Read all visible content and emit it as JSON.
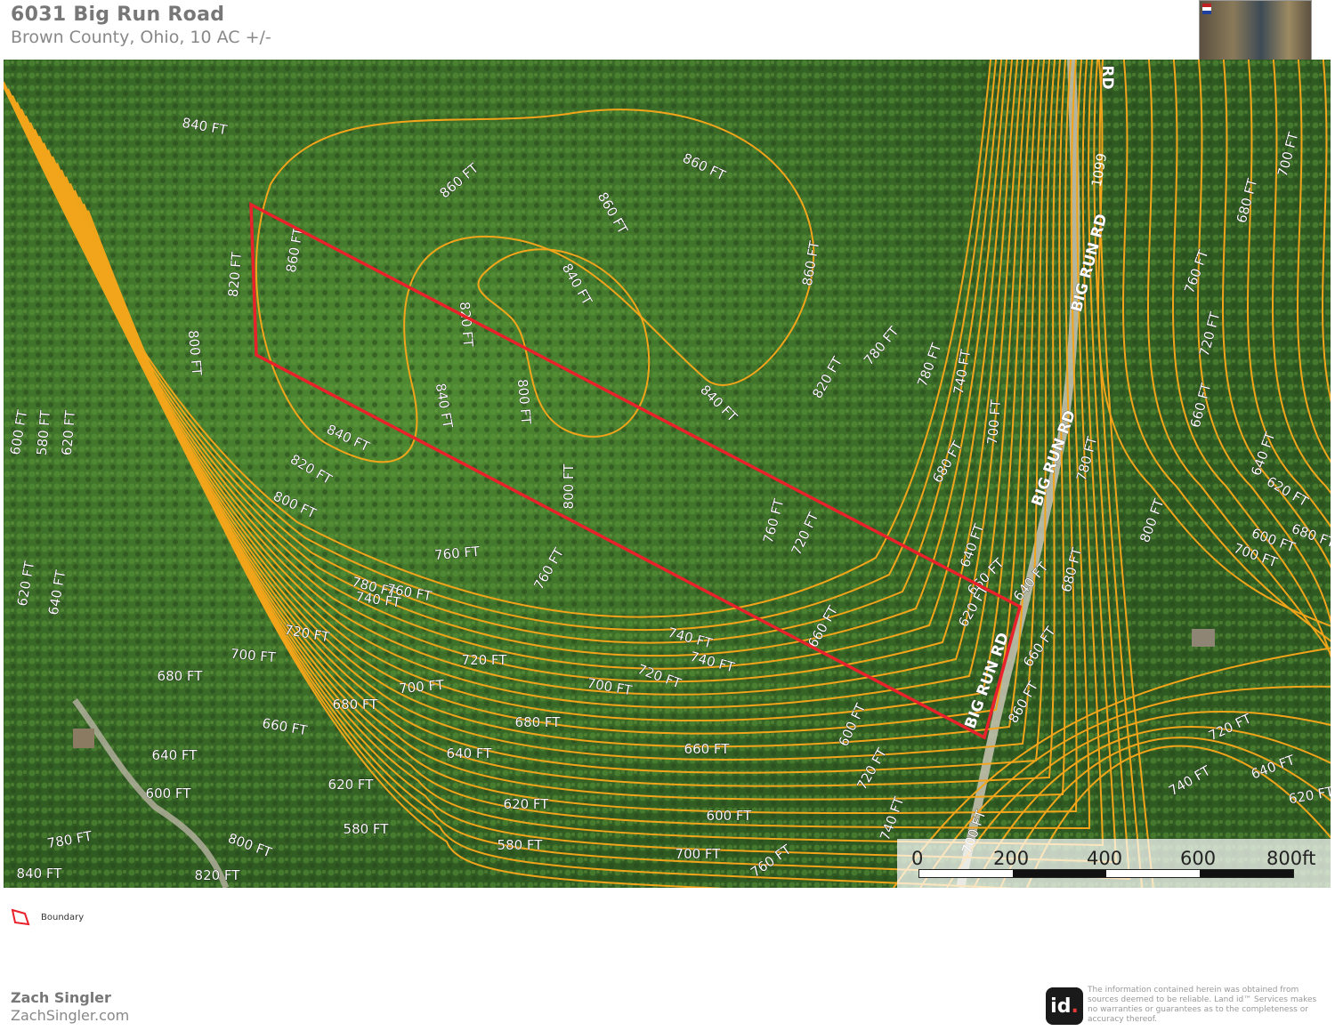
{
  "header": {
    "title": "6031 Big Run Road",
    "subtitle": "Brown County, Ohio, 10 AC +/-"
  },
  "map": {
    "contour_color": "#f2a51a",
    "boundary_color": "#e8212b",
    "contour_labels": [
      "840 FT",
      "860 FT",
      "860 FT",
      "860 FT",
      "860 FT",
      "860 FT",
      "840 FT",
      "840 FT",
      "840 FT",
      "840 FT",
      "820 FT",
      "820 FT",
      "820 FT",
      "820 FT",
      "800 FT",
      "800 FT",
      "800 FT",
      "800 FT",
      "780 FT",
      "780 FT",
      "780 FT",
      "760 FT",
      "760 FT",
      "760 FT",
      "760 FT",
      "740 FT",
      "740 FT",
      "740 FT",
      "740 FT",
      "720 FT",
      "720 FT",
      "720 FT",
      "720 FT",
      "700 FT",
      "700 FT",
      "700 FT",
      "700 FT",
      "680 FT",
      "680 FT",
      "680 FT",
      "680 FT",
      "660 FT",
      "660 FT",
      "660 FT",
      "660 FT",
      "640 FT",
      "640 FT",
      "640 FT",
      "640 FT",
      "620 FT",
      "620 FT",
      "620 FT",
      "600 FT",
      "600 FT",
      "600 FT",
      "580 FT",
      "580 FT",
      "700 FT",
      "720 FT",
      "740 FT",
      "760 FT",
      "780 FT",
      "800 FT",
      "820 FT",
      "840 FT",
      "860 FT",
      "780 FT",
      "800 FT",
      "760 FT",
      "720 FT",
      "680 FT",
      "700 FT",
      "660 FT",
      "640 FT",
      "620 FT",
      "600 FT",
      "680 FT",
      "700 FT",
      "720 FT",
      "740 FT",
      "640 FT",
      "620 FT",
      "660 FT",
      "680 FT",
      "700 FT",
      "620 FT",
      "640 FT",
      "600 FT",
      "580 FT",
      "620 FT"
    ],
    "road_labels": [
      "BIG RUN RD",
      "BIG RUN RD",
      "BIG RUN RD",
      "RD"
    ],
    "road_number": "1099"
  },
  "scalebar": {
    "labels": [
      "0",
      "200",
      "400",
      "600",
      "800ft"
    ]
  },
  "legend": {
    "label": "Boundary"
  },
  "footer": {
    "agent_name": "Zach Singler",
    "agent_site": "ZachSingler.com",
    "logo_text": "id",
    "logo_dot": ".",
    "disclaimer": "The information contained herein was obtained from sources deemed to be reliable. Land id™ Services makes no warranties or guarantees as to the completeness or accuracy thereof."
  }
}
